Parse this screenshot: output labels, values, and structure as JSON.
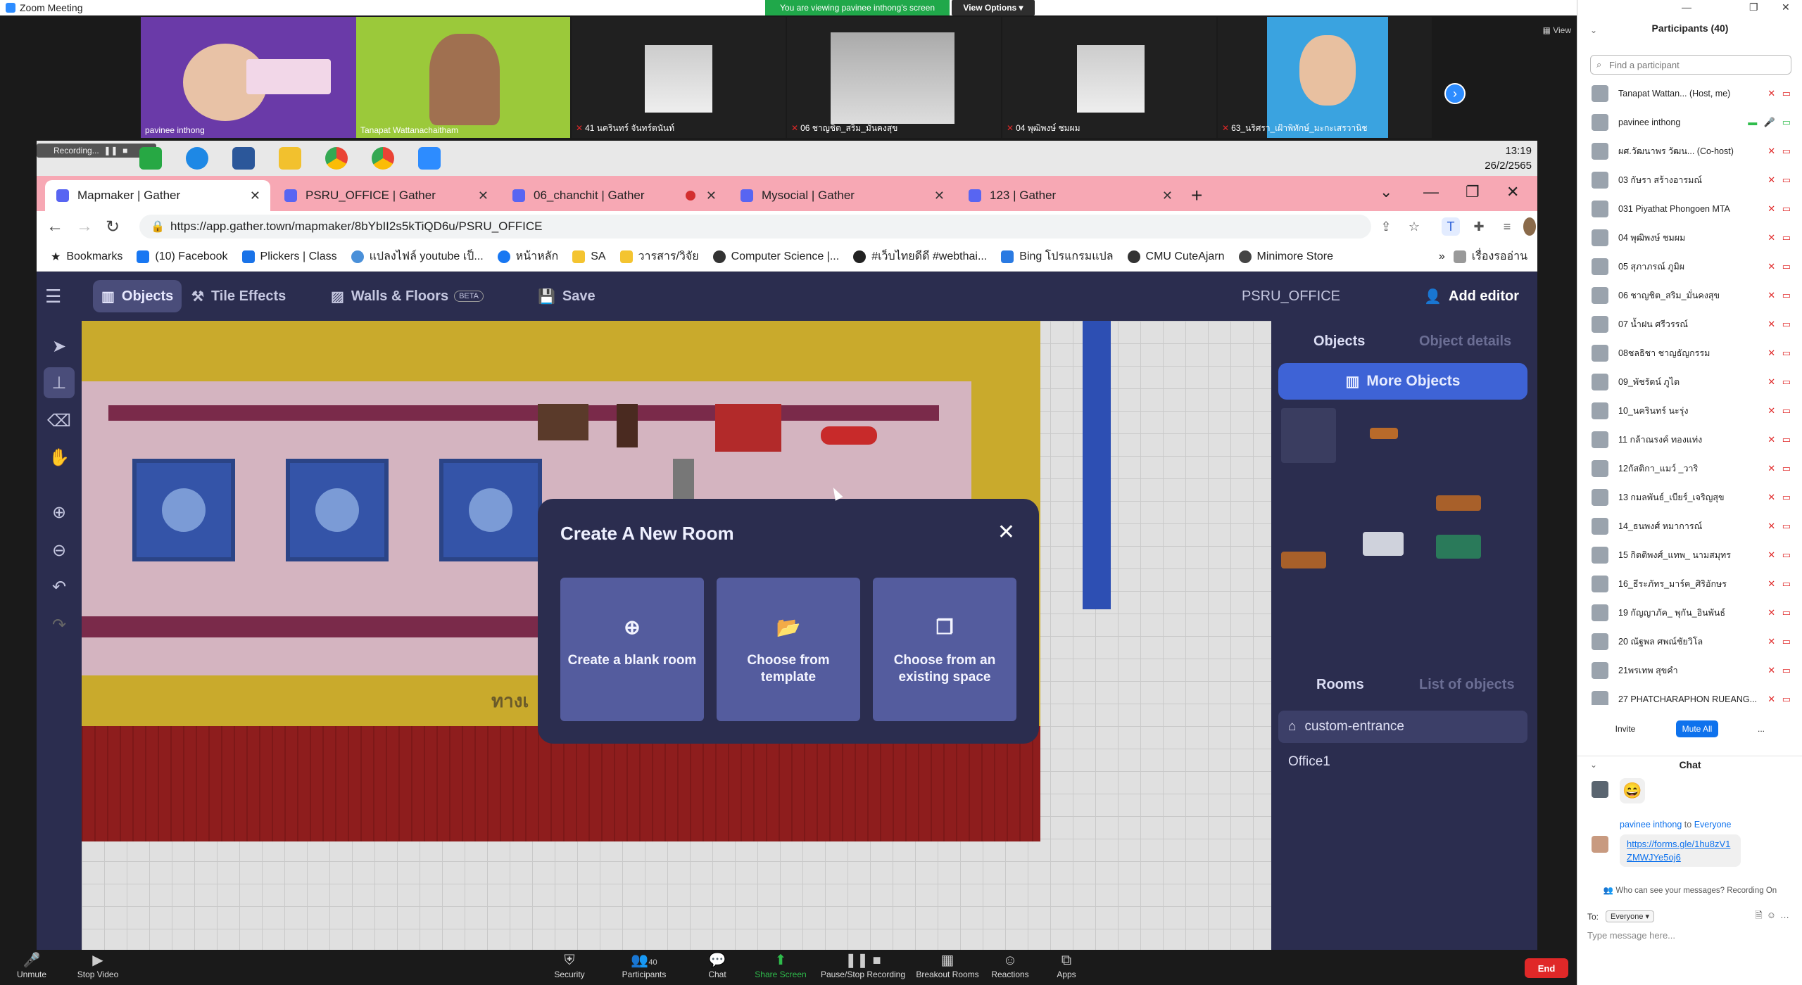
{
  "zoom": {
    "title": "Zoom Meeting",
    "viewing_banner": "You are viewing pavinee inthong's screen",
    "view_options": "View Options ▾",
    "view_label": "View",
    "tiles": [
      {
        "name": "pavinee inthong",
        "muted": false,
        "bg": "#6a3aa8"
      },
      {
        "name": "Tanapat Wattanachaitham",
        "muted": false,
        "bg": "#9bc93a"
      },
      {
        "name": "41 นครินทร์ จันทร์ตนันท์",
        "muted": true,
        "bg": "#1f1f1f"
      },
      {
        "name": "06 ชาญชิต_สริม_มั่นคงสุข",
        "muted": true,
        "bg": "#1f1f1f"
      },
      {
        "name": "04 พุฒิพงษ์ ชมผม",
        "muted": true,
        "bg": "#1f1f1f"
      },
      {
        "name": "63_นริศรา_เฝ้าพิทักษ์_มะกะเสรวานิช",
        "muted": true,
        "bg": "#3aa3e0"
      }
    ],
    "controls": {
      "unmute": "Unmute",
      "stop_video": "Stop Video",
      "security": "Security",
      "participants": "Participants",
      "participants_count": "40",
      "chat": "Chat",
      "share_screen": "Share Screen",
      "pause_recording": "Pause/Stop Recording",
      "breakout": "Breakout Rooms",
      "reactions": "Reactions",
      "apps": "Apps",
      "end": "End"
    }
  },
  "taskbar": {
    "recording_label": "Recording...",
    "time": "13:19",
    "date": "26/2/2565"
  },
  "browser": {
    "tabs": [
      {
        "title": "Mapmaker | Gather",
        "active": true
      },
      {
        "title": "PSRU_OFFICE | Gather",
        "active": false
      },
      {
        "title": "06_chanchit | Gather",
        "active": false,
        "recording": true
      },
      {
        "title": "Mysocial | Gather",
        "active": false
      },
      {
        "title": "123 | Gather",
        "active": false
      }
    ],
    "url": "https://app.gather.town/mapmaker/8bYbII2s5kTiQD6u/PSRU_OFFICE",
    "bookmarks": [
      "Bookmarks",
      "(10) Facebook",
      "Plickers | Class",
      "แปลงไฟล์ youtube เป็...",
      "หน้าหลัก",
      "SA",
      "วารสาร/วิจัย",
      "Computer Science |...",
      "#เว็บไทยดีดี #webthai...",
      "Bing โปรแกรมแปล",
      "CMU CuteAjarn",
      "Minimore Store"
    ],
    "reading_list": "เรื่องรออ่าน"
  },
  "gather": {
    "toolbar": {
      "objects": "Objects",
      "tile_effects": "Tile Effects",
      "walls_floors": "Walls & Floors",
      "beta": "BETA",
      "save": "Save",
      "room_name": "PSRU_OFFICE",
      "add_editor": "Add editor"
    },
    "map_sign": "ทางเ",
    "sidebar": {
      "tab_objects": "Objects",
      "tab_object_details": "Object details",
      "more_objects": "More Objects",
      "tab_rooms": "Rooms",
      "tab_list_objects": "List of objects",
      "rooms": [
        "custom-entrance",
        "Office1"
      ]
    },
    "modal": {
      "title": "Create A New Room",
      "options": [
        "Create a blank room",
        "Choose from template",
        "Choose from an existing space"
      ]
    }
  },
  "participants_panel": {
    "header": "Participants (40)",
    "search_placeholder": "Find a participant",
    "participants": [
      "Tanapat Wattan...  (Host, me)",
      "pavinee inthong",
      "ผศ.วัฒนาพร วัฒน...  (Co-host)",
      "03 กัษรา สร้างอารมณ์",
      "031 Piyathat Phongoen MTA",
      "04 พุฒิพงษ์ ชมผม",
      "05 สุภาภรณ์ ภูมิผ",
      "06 ชาญชิต_สริม_มั่นคงสุข",
      "07 น้ำฝน ศรีวรรณ์",
      "08ชลธิชา ชาญธัญกรรม",
      "09_พัชรัตน์ ภูไต",
      "10_นครินทร์ นะรุ่ง",
      "11 กล้าณรงค์ ทองแท่ง",
      "12กัสติกา_แมว์ _วาริ",
      "13 กมลพันธ์_เบียร์_เจริญสุข",
      "14_ธนพงศ์ หมาการณ์",
      "15 กิตติพงศ์_แทพ_ นามสมุทร",
      "16_ธีระภัทร_มาร์ค_ศิริอักษร",
      "19 กัญญาภัค_ พุกัน_อินพันธ์",
      "20 ณัฐพล ศพณ์ชัยวิโล",
      "21พรเทพ สุขคำ",
      "27 PHATCHARAPHON RUEANG..."
    ],
    "invite": "Invite",
    "mute_all": "Mute All",
    "more": "...",
    "chat": {
      "header": "Chat",
      "emoji": "😄",
      "sender": "pavinee inthong",
      "to_word": "to",
      "to_target": "Everyone",
      "link": "https://forms.gle/1hu8zV1ZMWJYe5oj6",
      "notice": "Who can see your messages? Recording On",
      "to_label": "To:",
      "to_select": "Everyone ▾",
      "input_placeholder": "Type message here..."
    }
  }
}
